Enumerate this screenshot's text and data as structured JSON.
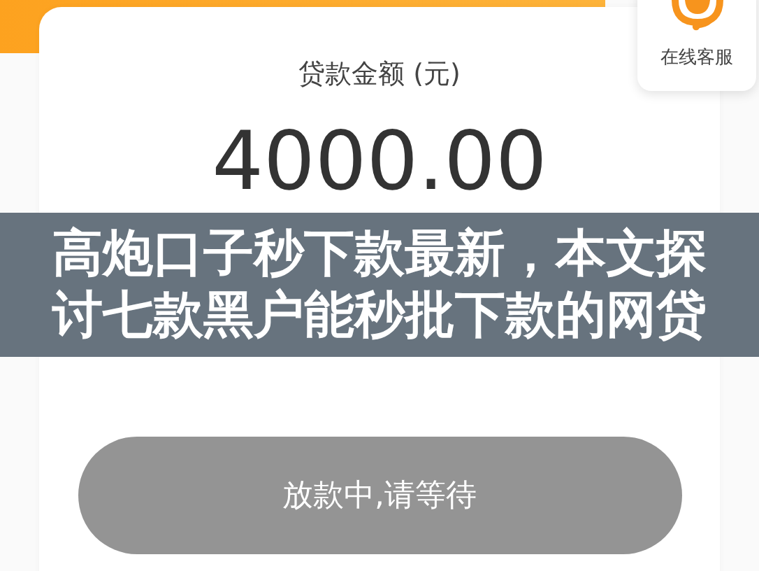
{
  "loan_card": {
    "label": "贷款金额 (元)",
    "amount": "4000.00",
    "button": {
      "label": "放款中,请等待",
      "disabled": true
    }
  },
  "support_widget": {
    "label": "在线客服"
  },
  "caption": {
    "text": "高炮口子秒下款最新，本文探讨七款黑户能秒批下款的网贷"
  }
}
